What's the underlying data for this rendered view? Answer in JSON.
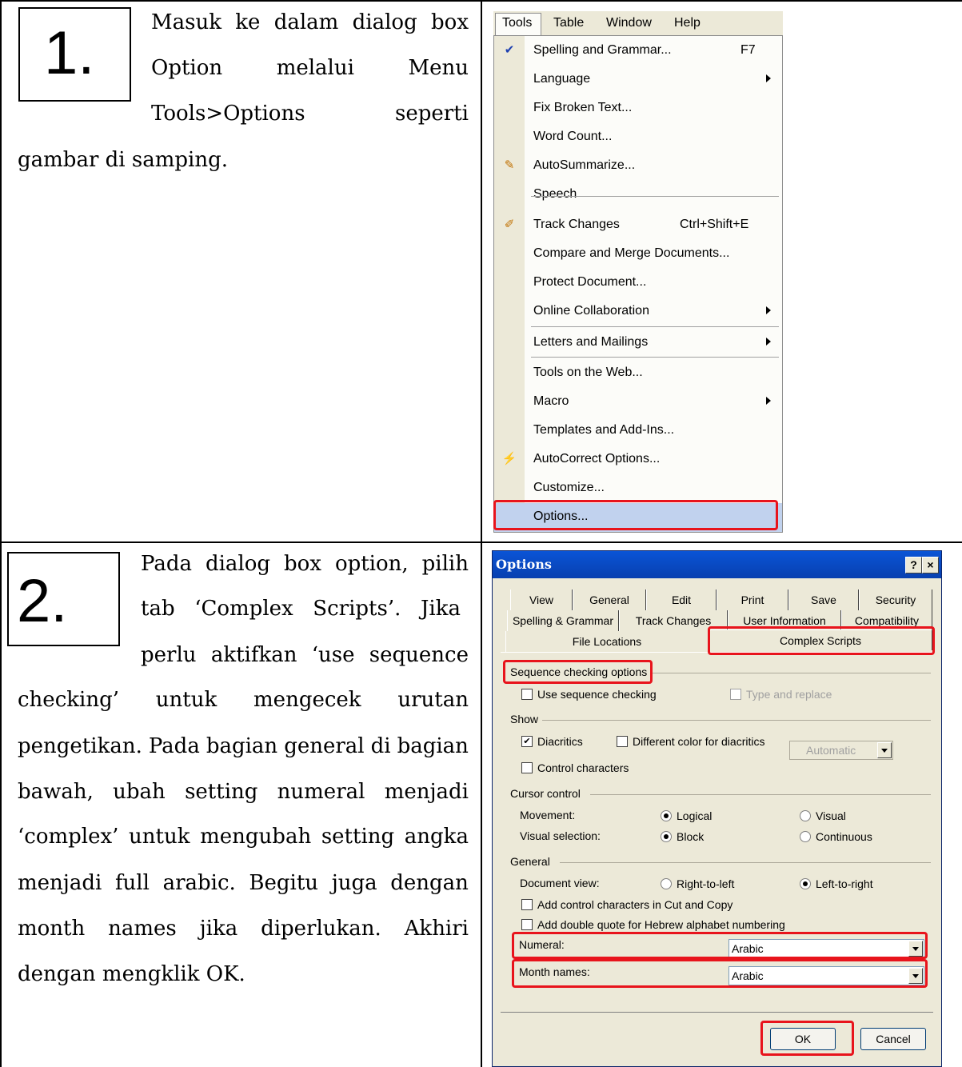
{
  "step1": {
    "number": "1.",
    "lines": [
      [
        "Masuk",
        "ke",
        "dalam",
        "dialog",
        "box"
      ],
      [
        "Option",
        "melalui",
        "Menu"
      ],
      [
        "Tools>Options",
        "seperti"
      ],
      [
        "gambar di samping."
      ]
    ]
  },
  "step2": {
    "number": "2.",
    "lines": [
      [
        "Pada",
        "dialog",
        "box",
        "option,",
        "pilih"
      ],
      [
        "tab",
        "‘Complex",
        "Scripts’.",
        "Jika"
      ],
      [
        "perlu",
        "aktifkan",
        "‘use",
        "sequence"
      ],
      [
        "checking’",
        "untuk",
        "mengecek",
        "urutan"
      ],
      [
        "pengetikan.",
        "Pada",
        "bagian",
        "general",
        "di",
        "bagian"
      ],
      [
        "bawah,",
        "ubah",
        "setting",
        "numeral",
        "menjadi"
      ],
      [
        "‘complex’",
        "untuk",
        "mengubah",
        "setting",
        "angka"
      ],
      [
        "menjadi",
        "full",
        "arabic.",
        "Begitu",
        "juga",
        "dengan"
      ],
      [
        "month",
        "names",
        "jika",
        "diperlukan.",
        "Akhiri"
      ],
      [
        "dengan mengklik OK."
      ]
    ]
  },
  "menubar": {
    "items": [
      "Tools",
      "Table",
      "Window",
      "Help"
    ]
  },
  "tools_menu": {
    "items": [
      {
        "label": "Spelling and Grammar...",
        "shortcut": "F7",
        "icon": "spelling-icon",
        "glyph": "✔"
      },
      {
        "label": "Language",
        "submenu": true
      },
      {
        "label": "Fix Broken Text..."
      },
      {
        "label": "Word Count..."
      },
      {
        "label": "AutoSummarize...",
        "icon": "autosummarize-icon",
        "glyph": "✎"
      },
      {
        "label": "Speech"
      },
      {
        "label": "Track Changes",
        "shortcut": "Ctrl+Shift+E",
        "icon": "track-changes-icon",
        "glyph": "✐"
      },
      {
        "label": "Compare and Merge Documents..."
      },
      {
        "label": "Protect Document..."
      },
      {
        "label": "Online Collaboration",
        "submenu": true
      },
      {
        "label": "Letters and Mailings",
        "submenu": true
      },
      {
        "label": "Tools on the Web..."
      },
      {
        "label": "Macro",
        "submenu": true
      },
      {
        "label": "Templates and Add-Ins..."
      },
      {
        "label": "AutoCorrect Options...",
        "icon": "autocorrect-icon",
        "glyph": "⚡"
      },
      {
        "label": "Customize..."
      },
      {
        "label": "Options...",
        "highlighted": true
      }
    ]
  },
  "options_dialog": {
    "title": "Options",
    "help_button": "?",
    "close_button": "×",
    "tabs_row1": [
      "View",
      "General",
      "Edit",
      "Print",
      "Save",
      "Security"
    ],
    "tabs_row2": [
      "Spelling & Grammar",
      "Track Changes",
      "User Information",
      "Compatibility"
    ],
    "tabs_row3": [
      "File Locations",
      "Complex Scripts"
    ],
    "sequence_group": "Sequence checking options",
    "use_sequence": "Use sequence checking",
    "type_replace": "Type and replace",
    "show_group": "Show",
    "diacritics": "Diacritics",
    "diff_color": "Different color for diacritics",
    "diacritics_color": "Automatic",
    "control_chars": "Control characters",
    "cursor_group": "Cursor control",
    "movement": "Movement:",
    "logical": "Logical",
    "visual": "Visual",
    "visual_selection": "Visual selection:",
    "block": "Block",
    "continuous": "Continuous",
    "general_group": "General",
    "document_view": "Document view:",
    "rtl": "Right-to-left",
    "ltr": "Left-to-right",
    "add_control": "Add control characters in Cut and Copy",
    "add_double": "Add double quote for Hebrew alphabet numbering",
    "numeral_label": "Numeral:",
    "numeral_value": "Arabic",
    "month_label": "Month names:",
    "month_value": "Arabic",
    "ok": "OK",
    "cancel": "Cancel",
    "check_mark": "✔"
  },
  "colors": {
    "highlight_box": "#e8141c",
    "titlebar": "#0a54d6",
    "dialog_bg": "#ece9d8",
    "menu_highlight": "#c1d2ee"
  }
}
